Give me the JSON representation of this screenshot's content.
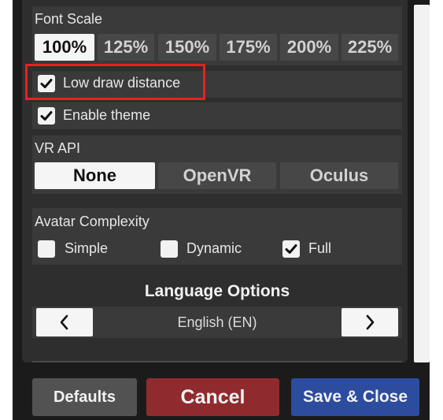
{
  "font_scale": {
    "label": "Font Scale",
    "options": [
      "100%",
      "125%",
      "150%",
      "175%",
      "200%",
      "225%"
    ],
    "selected": "100%"
  },
  "checkboxes": {
    "low_draw_distance": {
      "label": "Low draw distance",
      "checked": true
    },
    "enable_theme": {
      "label": "Enable theme",
      "checked": true
    }
  },
  "vr_api": {
    "label": "VR API",
    "options": [
      "None",
      "OpenVR",
      "Oculus"
    ],
    "selected": "None"
  },
  "avatar_complexity": {
    "label": "Avatar Complexity",
    "options": [
      {
        "label": "Simple",
        "checked": false
      },
      {
        "label": "Dynamic",
        "checked": false
      },
      {
        "label": "Full",
        "checked": true
      }
    ]
  },
  "language": {
    "title": "Language Options",
    "current": "English (EN)"
  },
  "footer": {
    "defaults_label": "Defaults",
    "cancel_label": "Cancel",
    "save_close_label": "Save & Close"
  },
  "colors": {
    "cancel": "#8f2b2e",
    "save_close": "#2c4c9e",
    "defaults": "#525252",
    "highlight": "#e62222"
  }
}
